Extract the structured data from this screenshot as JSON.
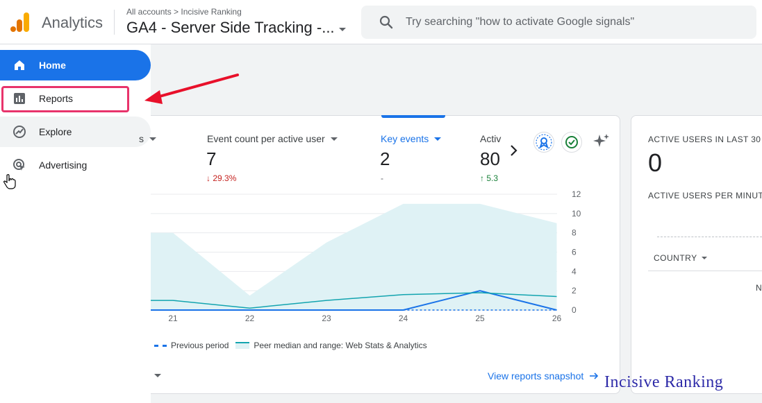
{
  "header": {
    "brand": "Analytics",
    "breadcrumb_root": "All accounts",
    "breadcrumb_sep": ">",
    "breadcrumb_account": "Incisive Ranking",
    "property_name": "GA4 - Server Side Tracking -...",
    "search_placeholder": "Try searching \"how to activate Google signals\""
  },
  "sidebar": {
    "items": [
      {
        "label": "Home",
        "icon": "home-icon",
        "active": true
      },
      {
        "label": "Reports",
        "icon": "bar-chart-icon"
      },
      {
        "label": "Explore",
        "icon": "explore-icon"
      },
      {
        "label": "Advertising",
        "icon": "advertising-icon"
      }
    ]
  },
  "metrics": [
    {
      "label": "s",
      "value": "",
      "change": ""
    },
    {
      "label": "Event count per active user",
      "value": "7",
      "change": "↓ 29.3%",
      "direction": "down"
    },
    {
      "label": "Key events",
      "value": "2",
      "change": "-",
      "direction": "none",
      "active": true
    },
    {
      "label": "Activ",
      "value": "80",
      "change": "↑ 5.3",
      "direction": "up"
    }
  ],
  "chart_data": {
    "type": "line",
    "categories": [
      "21",
      "22",
      "23",
      "24",
      "25",
      "26"
    ],
    "yticks": [
      "0",
      "2",
      "4",
      "6",
      "8",
      "10",
      "12"
    ],
    "ylim": [
      0,
      12
    ],
    "series": [
      {
        "name": "Key events",
        "x": [
          20,
          21,
          22,
          23,
          24,
          25,
          26
        ],
        "values": [
          0,
          0,
          0,
          0,
          0,
          2,
          0
        ]
      },
      {
        "name": "Previous period",
        "x": [
          24,
          25,
          26
        ],
        "values": [
          0,
          0,
          0
        ]
      },
      {
        "name": "Peer median and range: Web Stats & Analytics",
        "x": [
          20,
          21,
          22,
          23,
          24,
          25,
          26
        ],
        "values": [
          1,
          1,
          0.2,
          1,
          1.6,
          1.8,
          1.4
        ]
      }
    ],
    "band": {
      "x": [
        20,
        21,
        22,
        23,
        24,
        25,
        26
      ],
      "upper": [
        8,
        8,
        1.5,
        7,
        11,
        11,
        9
      ],
      "lower": [
        0,
        0,
        0,
        0,
        0,
        0,
        0
      ]
    },
    "grid": true,
    "legend": [
      "Previous period",
      "Peer median and range: Web Stats & Analytics"
    ],
    "colors": {
      "primary": "#1a73e8",
      "peer_line": "#12a4af",
      "peer_band": "#dff2f5"
    }
  },
  "actions": {
    "snapshot": "View reports snapshot"
  },
  "realtime": {
    "title": "ACTIVE USERS IN LAST 30 M",
    "value": "0",
    "per_minute": "ACTIVE USERS PER MINUTE",
    "country_label": "COUNTRY",
    "truncated": "N"
  },
  "watermark": "Incisive Ranking",
  "colors": {
    "accent": "#1a73e8",
    "highlight": "#e8336b",
    "annotation_arrow": "#e8102a"
  }
}
